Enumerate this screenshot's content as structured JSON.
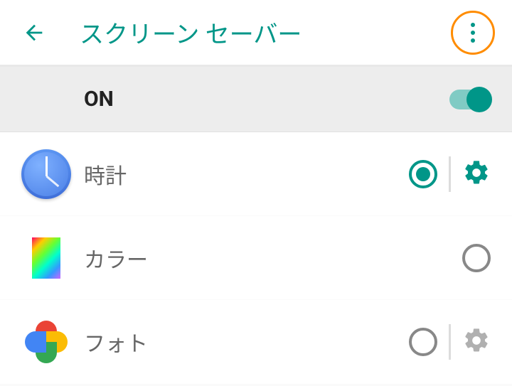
{
  "header": {
    "title": "スクリーン セーバー"
  },
  "switch": {
    "label": "ON",
    "on": true
  },
  "options": [
    {
      "id": "clock",
      "label": "時計",
      "selected": true,
      "has_settings": true,
      "settings_enabled": true
    },
    {
      "id": "colors",
      "label": "カラー",
      "selected": false,
      "has_settings": false
    },
    {
      "id": "photos",
      "label": "フォト",
      "selected": false,
      "has_settings": true,
      "settings_enabled": false
    }
  ],
  "colors": {
    "accent": "#009688",
    "highlight_ring": "#ff8c00"
  }
}
